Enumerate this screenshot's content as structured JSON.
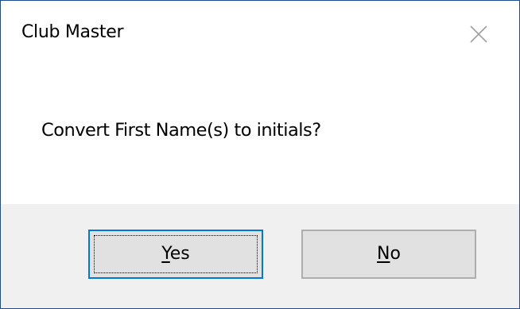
{
  "window": {
    "title": "Club Master",
    "close_icon": "close-icon"
  },
  "message": {
    "text": "Convert First Name(s) to initials?"
  },
  "buttons": {
    "yes": {
      "accelerator": "Y",
      "rest": "es",
      "is_default": true
    },
    "no": {
      "accelerator": "N",
      "rest": "o",
      "is_default": false
    }
  },
  "colors": {
    "window_border": "#1e4e90",
    "footer_bg": "#f0f0f0",
    "button_bg": "#e1e1e1",
    "button_border": "#adadad",
    "default_button_border": "#0078d7"
  }
}
